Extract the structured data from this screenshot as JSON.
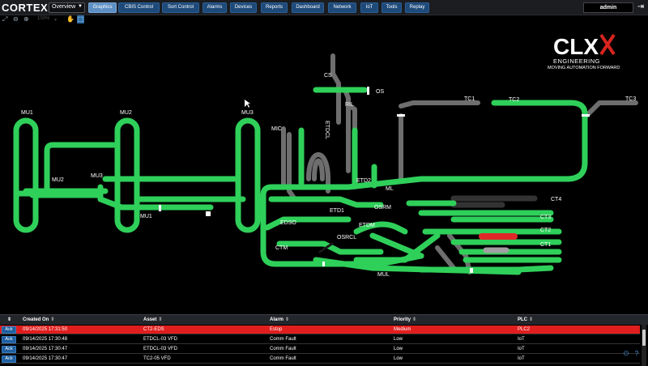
{
  "app": {
    "logo": "CORTEX"
  },
  "view_select": {
    "value": "Overview"
  },
  "nav": [
    {
      "label": "Graphics",
      "active": true
    },
    {
      "label": "CBIS Control"
    },
    {
      "label": "Sort Control"
    },
    {
      "label": "Alarms"
    },
    {
      "label": "Devices"
    },
    {
      "label": "Reports"
    },
    {
      "label": "Dashboard"
    },
    {
      "label": "Network"
    },
    {
      "label": "IoT"
    },
    {
      "label": "Tools"
    },
    {
      "label": "Replay"
    }
  ],
  "user": {
    "name": "admin"
  },
  "toolbar": {
    "zoom": "100%"
  },
  "brand": {
    "letters": "CLX",
    "subtitle": "ENGINEERING",
    "tagline": "MOVING AUTOMATION FORWARD"
  },
  "map_labels": {
    "MU1": "MU1",
    "MU2": "MU2",
    "MU3": "MU3",
    "MU2b": "MU2",
    "MU1b": "MU1",
    "MU3b": "MU3",
    "CS": "CS",
    "OS": "OS",
    "RIL": "RIL",
    "ETDCL": "ETDCL",
    "MIC": "MIC",
    "TC1": "TC1",
    "TC2": "TC2",
    "TC3": "TC3",
    "ETD2": "ETD2",
    "ML": "ML",
    "ETD1": "ETD1",
    "EDSO": "EDSO",
    "ETDM": "ETDM",
    "OSRM": "OSRM",
    "OSRCL": "OSRCL",
    "CTM": "CTM",
    "MUL": "MUL",
    "CT4": "CT4",
    "CT3": "CT3",
    "CT2": "CT2",
    "CT1": "CT1"
  },
  "colors": {
    "conveyor_on": "#2fd05a",
    "conveyor_off": "#6e6e6e",
    "alarm_red": "#e02828",
    "alarm_row": "#e01e1e",
    "nav_active": "#5d8fc4"
  },
  "alarm_table": {
    "columns": [
      "Created On",
      "Asset",
      "Alarm",
      "Priority",
      "PLC"
    ],
    "ack_label": "Ack",
    "rows": [
      {
        "created": "09/14/2025 17:31:50",
        "asset": "CT2-EDS",
        "alarm": "Estop",
        "priority": "Medium",
        "plc": "PLC2",
        "severity": "high"
      },
      {
        "created": "09/14/2025 17:30:48",
        "asset": "ETDCL-03 VFD",
        "alarm": "Comm Fault",
        "priority": "Low",
        "plc": "IoT",
        "severity": "low"
      },
      {
        "created": "09/14/2025 17:30:47",
        "asset": "ETDCL-03 VFD",
        "alarm": "Comm Fault",
        "priority": "Low",
        "plc": "IoT",
        "severity": "low"
      },
      {
        "created": "09/14/2025 17:30:47",
        "asset": "TC2-05 VFD",
        "alarm": "Comm Fault",
        "priority": "Low",
        "plc": "IoT",
        "severity": "low"
      }
    ]
  }
}
